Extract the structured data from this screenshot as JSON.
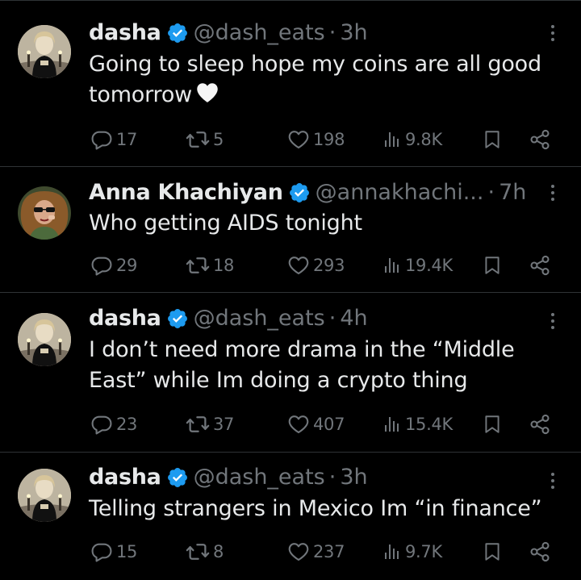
{
  "tweets": [
    {
      "name": "dasha",
      "handle": "@dash_eats",
      "separator": "·",
      "time": "3h",
      "text": "Going to sleep hope my coins are all good tomorrow",
      "emoji": "white-heart",
      "replies": "17",
      "retweets": "5",
      "likes": "198",
      "views": "9.8K"
    },
    {
      "name": "Anna Khachiyan",
      "handle": "@annakhachi...",
      "separator": "·",
      "time": "7h",
      "text": "Who getting AIDS tonight",
      "replies": "29",
      "retweets": "18",
      "likes": "293",
      "views": "19.4K"
    },
    {
      "name": "dasha",
      "handle": "@dash_eats",
      "separator": "·",
      "time": "4h",
      "text": "I don’t need more drama in the “Middle East” while Im doing a crypto thing",
      "replies": "23",
      "retweets": "37",
      "likes": "407",
      "views": "15.4K"
    },
    {
      "name": "dasha",
      "handle": "@dash_eats",
      "separator": "·",
      "time": "3h",
      "text": "Telling strangers in Mexico Im “in finance”",
      "replies": "15",
      "retweets": "8",
      "likes": "237",
      "views": "9.7K"
    }
  ],
  "colors": {
    "background": "#000000",
    "text": "#e7e9ea",
    "secondary": "#71767b",
    "verified": "#1d9bf0",
    "divider": "#2f3336"
  },
  "icons": [
    "verified-badge-icon",
    "more-icon",
    "reply-icon",
    "retweet-icon",
    "like-icon",
    "views-icon",
    "bookmark-icon",
    "share-icon",
    "white-heart-emoji"
  ]
}
